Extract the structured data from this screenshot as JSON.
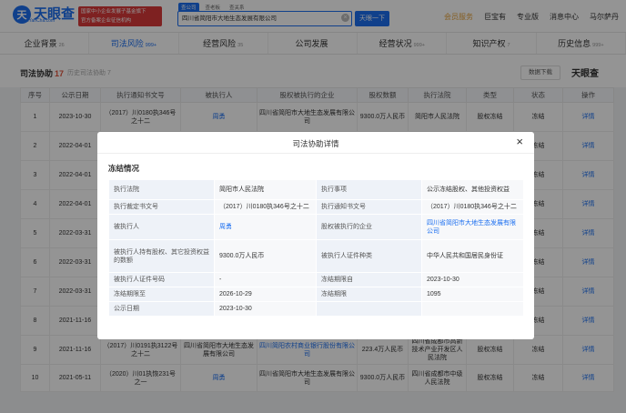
{
  "header": {
    "logo_mark": "天",
    "logo_text": "天眼查",
    "logo_sub": "TianYanCha.com",
    "banner_line1": "国家中小企业发展子基金旗下",
    "banner_line2": "官方备案企业征信机构",
    "search_tabs": [
      "查公司",
      "查老板",
      "查关系"
    ],
    "search_value": "四川省简阳市大地生态发展有限公司",
    "search_button": "天眼一下",
    "nav": [
      "会员服务",
      "巨宝有",
      "专业版",
      "消息中心",
      "马尔萨丹"
    ]
  },
  "subnav": [
    {
      "label": "企业背景",
      "count": "26"
    },
    {
      "label": "司法风险",
      "count": "999+"
    },
    {
      "label": "经营风险",
      "count": "35"
    },
    {
      "label": "公司发展",
      "count": ""
    },
    {
      "label": "经营状况",
      "count": "999+"
    },
    {
      "label": "知识产权",
      "count": "7"
    },
    {
      "label": "历史信息",
      "count": "999+"
    }
  ],
  "section": {
    "title": "司法协助",
    "count": "17",
    "sub": "历史司法协助 7",
    "export": "数据下载",
    "brand": "天眼查"
  },
  "table": {
    "headers": [
      "序号",
      "公示日期",
      "执行通知书文号",
      "被执行人",
      "股权被执行的企业",
      "股权数额",
      "执行法院",
      "类型",
      "状态",
      "操作"
    ],
    "rows": [
      [
        "1",
        "2023-10-30",
        "（2017）川0180执346号之十二",
        "周勇",
        "四川省简阳市大地生态发展有限公司",
        "9300.0万人民币",
        "简阳市人民法院",
        "股权冻结",
        "冻结",
        "详情"
      ],
      [
        "2",
        "2022-04-01",
        "",
        "",
        "",
        "",
        "",
        "",
        "冻结",
        "详情"
      ],
      [
        "3",
        "2022-04-01",
        "",
        "",
        "",
        "",
        "",
        "",
        "冻结",
        "详情"
      ],
      [
        "4",
        "2022-04-01",
        "",
        "",
        "",
        "",
        "",
        "",
        "冻结",
        "详情"
      ],
      [
        "5",
        "2022-03-31",
        "",
        "",
        "",
        "",
        "",
        "",
        "冻结",
        "详情"
      ],
      [
        "6",
        "2022-03-31",
        "",
        "",
        "",
        "",
        "",
        "",
        "冻结",
        "详情"
      ],
      [
        "7",
        "2022-03-31",
        "",
        "",
        "",
        "",
        "",
        "",
        "冻结",
        "详情"
      ],
      [
        "8",
        "2021-11-16",
        "",
        "",
        "",
        "",
        "",
        "",
        "冻结",
        "详情"
      ],
      [
        "9",
        "2021-11-16",
        "（2017）川0191执3122号之十二",
        "四川省简阳市大地生态发展有限公司",
        "四川简阳农村商业银行股份有限公司",
        "223.4万人民币",
        "四川省成都市高新技术产业开发区人民法院",
        "股权冻结",
        "冻结",
        "详情"
      ],
      [
        "10",
        "2021-05-11",
        "（2020）川01执恢231号之一",
        "周勇",
        "四川省简阳市大地生态发展有限公司",
        "9300.0万人民币",
        "四川省成都市中级人民法院",
        "股权冻结",
        "冻结",
        "详情"
      ]
    ]
  },
  "modal": {
    "title": "司法协助详情",
    "close": "×",
    "section": "冻结情况",
    "rows": [
      [
        "执行法院",
        "简阳市人民法院",
        "执行事项",
        "公示冻结股权、其他投资权益"
      ],
      [
        "执行裁定书文号",
        "（2017）川0180执346号之十二",
        "执行通知书文号",
        "（2017）川0180执346号之十二"
      ],
      [
        "被执行人",
        "周勇",
        "股权被执行的企业",
        "四川省简阳市大地生态发展有限公司"
      ],
      [
        "被执行人持有股权、其它投资权益的数额",
        "9300.0万人民币",
        "被执行人证件种类",
        "中华人民共和国居民身份证"
      ],
      [
        "被执行人证件号码",
        "-",
        "冻结期限自",
        "2023-10-30"
      ],
      [
        "冻结期限至",
        "2026-10-29",
        "冻结期限",
        "1095"
      ],
      [
        "公示日期",
        "2023-10-30",
        "",
        ""
      ]
    ]
  }
}
